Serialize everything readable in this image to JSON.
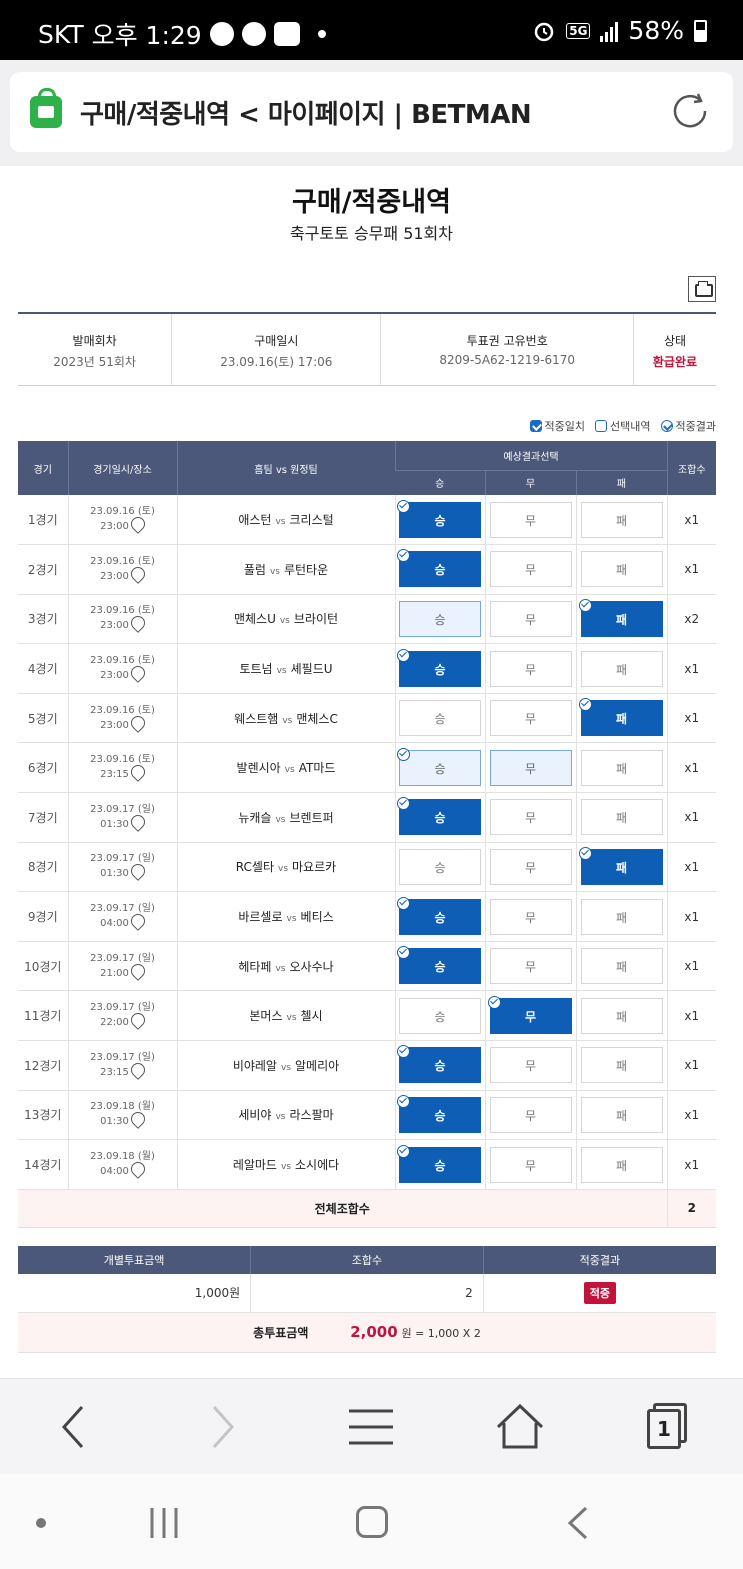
{
  "status_bar": {
    "carrier": "SKT",
    "time": "오후 1:29",
    "network": "5G",
    "battery": "58%"
  },
  "browser": {
    "page_title": "구매/적중내역 < 마이페이지 | BETMAN"
  },
  "page": {
    "title": "구매/적중내역",
    "subtitle": "축구토토 승무패 51회차"
  },
  "info": {
    "headers": [
      "발매회차",
      "구매일시",
      "투표권 고유번호",
      "상태"
    ],
    "values": [
      "2023년 51회차",
      "23.09.16(토) 17:06",
      "8209-5A62-1219-6170",
      "환급완료"
    ]
  },
  "legend": {
    "hit": "적중일치",
    "selected": "선택내역",
    "result": "적중결과"
  },
  "table": {
    "headers": {
      "game": "경기",
      "datetime": "경기일시/장소",
      "teams": "홈팀 vs 원정팀",
      "prediction": "예상결과선택",
      "win": "승",
      "draw": "무",
      "loss": "패",
      "combos": "조합수"
    },
    "vs": "vs",
    "rows": [
      {
        "game": "1경기",
        "date": "23.09.16 (토)",
        "time": "23:00",
        "home": "애스턴",
        "away": "크리스털",
        "win": "승",
        "draw": "무",
        "loss": "패",
        "combos": "x1"
      },
      {
        "game": "2경기",
        "date": "23.09.16 (토)",
        "time": "23:00",
        "home": "풀럼",
        "away": "루턴타운",
        "win": "승",
        "draw": "무",
        "loss": "패",
        "combos": "x1"
      },
      {
        "game": "3경기",
        "date": "23.09.16 (토)",
        "time": "23:00",
        "home": "맨체스U",
        "away": "브라이턴",
        "win": "승",
        "draw": "무",
        "loss": "패",
        "combos": "x2"
      },
      {
        "game": "4경기",
        "date": "23.09.16 (토)",
        "time": "23:00",
        "home": "토트넘",
        "away": "셰필드U",
        "win": "승",
        "draw": "무",
        "loss": "패",
        "combos": "x1"
      },
      {
        "game": "5경기",
        "date": "23.09.16 (토)",
        "time": "23:00",
        "home": "웨스트햄",
        "away": "맨체스C",
        "win": "승",
        "draw": "무",
        "loss": "패",
        "combos": "x1"
      },
      {
        "game": "6경기",
        "date": "23.09.16 (토)",
        "time": "23:15",
        "home": "발렌시아",
        "away": "AT마드",
        "win": "승",
        "draw": "무",
        "loss": "패",
        "combos": "x1"
      },
      {
        "game": "7경기",
        "date": "23.09.17 (일)",
        "time": "01:30",
        "home": "뉴캐슬",
        "away": "브렌트퍼",
        "win": "승",
        "draw": "무",
        "loss": "패",
        "combos": "x1"
      },
      {
        "game": "8경기",
        "date": "23.09.17 (일)",
        "time": "01:30",
        "home": "RC셀타",
        "away": "마요르카",
        "win": "승",
        "draw": "무",
        "loss": "패",
        "combos": "x1"
      },
      {
        "game": "9경기",
        "date": "23.09.17 (일)",
        "time": "04:00",
        "home": "바르셀로",
        "away": "베티스",
        "win": "승",
        "draw": "무",
        "loss": "패",
        "combos": "x1"
      },
      {
        "game": "10경기",
        "date": "23.09.17 (일)",
        "time": "21:00",
        "home": "헤타페",
        "away": "오사수나",
        "win": "승",
        "draw": "무",
        "loss": "패",
        "combos": "x1"
      },
      {
        "game": "11경기",
        "date": "23.09.17 (일)",
        "time": "22:00",
        "home": "본머스",
        "away": "첼시",
        "win": "승",
        "draw": "무",
        "loss": "패",
        "combos": "x1"
      },
      {
        "game": "12경기",
        "date": "23.09.17 (일)",
        "time": "23:15",
        "home": "비야레알",
        "away": "알메리아",
        "win": "승",
        "draw": "무",
        "loss": "패",
        "combos": "x1"
      },
      {
        "game": "13경기",
        "date": "23.09.18 (월)",
        "time": "01:30",
        "home": "세비야",
        "away": "라스팔마",
        "win": "승",
        "draw": "무",
        "loss": "패",
        "combos": "x1"
      },
      {
        "game": "14경기",
        "date": "23.09.18 (월)",
        "time": "04:00",
        "home": "레알마드",
        "away": "소시에다",
        "win": "승",
        "draw": "무",
        "loss": "패",
        "combos": "x1"
      }
    ],
    "total_label": "전체조합수",
    "total_value": "2"
  },
  "summary": {
    "headers": [
      "개별투표금액",
      "조합수",
      "적중결과"
    ],
    "amount": "1,000원",
    "combos": "2",
    "result": "적중",
    "grand_label": "총투표금액",
    "grand_value": "2,000",
    "grand_unit": "원 = 1,000 X 2"
  },
  "nav": {
    "tab_count": "1"
  },
  "colors": {
    "selected": "#0e5eb5",
    "header": "#4b5879",
    "accent_red": "#c0143c",
    "lock_green": "#2fb14a"
  }
}
